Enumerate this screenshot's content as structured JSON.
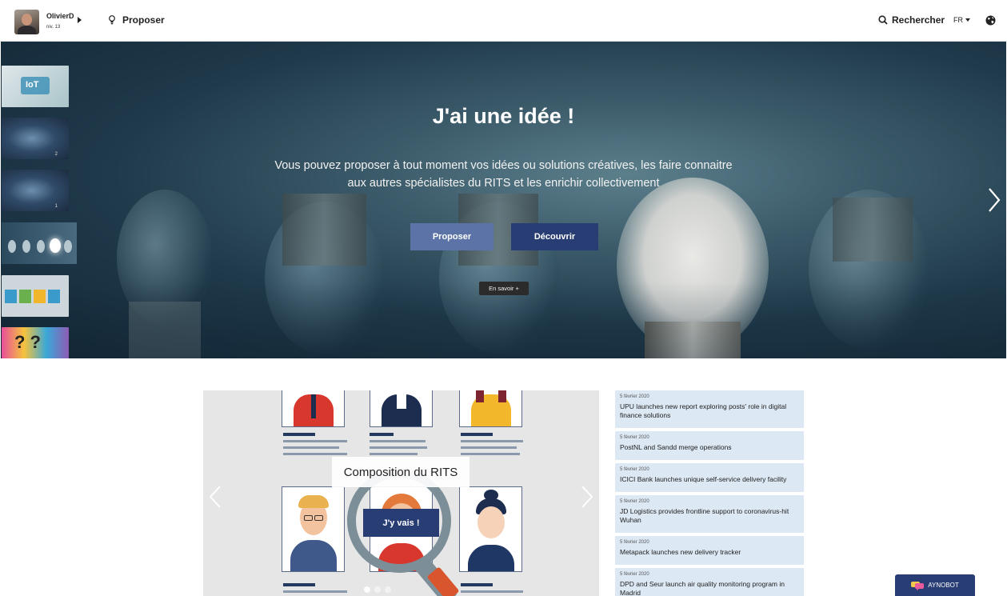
{
  "header": {
    "user_name": "OlivierD",
    "user_level": "niv. 13",
    "propose_label": "Proposer",
    "search_label": "Rechercher",
    "language": "FR"
  },
  "hero": {
    "title": "J'ai une idée !",
    "text": "Vous pouvez proposer à tout moment vos idées ou solutions créatives, les faire connaitre aux autres spécialistes du RITS et les enrichir collectivement",
    "btn_proposer": "Proposer",
    "btn_decouvrir": "Découvrir",
    "btn_en_savoir": "En savoir +",
    "thumbnails": [
      {
        "name": "iot",
        "num": ""
      },
      {
        "name": "network-2",
        "num": "2"
      },
      {
        "name": "network-1",
        "num": "1"
      },
      {
        "name": "bulbs",
        "num": ""
      },
      {
        "name": "info",
        "num": ""
      },
      {
        "name": "questions",
        "num": ""
      }
    ]
  },
  "carousel": {
    "title": "Composition du RITS",
    "button": "J'y vais !"
  },
  "news": [
    {
      "date": "5 février 2020",
      "title": "UPU launches new report exploring posts' role in digital finance solutions"
    },
    {
      "date": "5 février 2020",
      "title": "PostNL and Sandd merge operations"
    },
    {
      "date": "5 février 2020",
      "title": "ICICI Bank launches unique self-service delivery facility"
    },
    {
      "date": "5 février 2020",
      "title": "JD Logistics provides frontline support to coronavirus-hit Wuhan"
    },
    {
      "date": "5 février 2020",
      "title": "Metapack launches new delivery tracker"
    },
    {
      "date": "5 février 2020",
      "title": "DPD and Seur launch air quality monitoring program in Madrid"
    }
  ],
  "chatbot": {
    "label": "AYNOBOT"
  },
  "colors": {
    "primary_dark": "#273d74",
    "primary_light": "#5b73a6",
    "news_bg": "#dce8f4"
  }
}
